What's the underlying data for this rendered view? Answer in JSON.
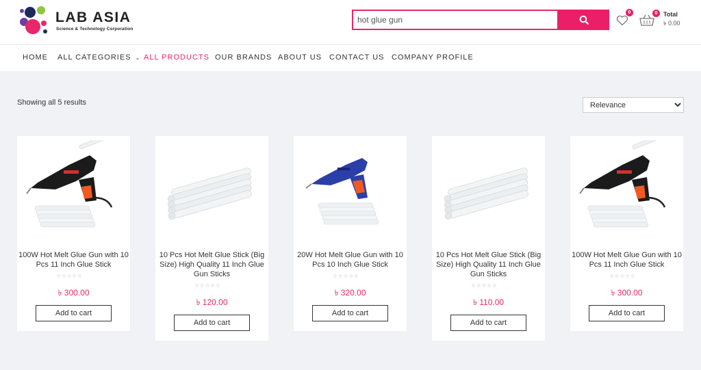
{
  "brand": {
    "title": "LAB ASIA",
    "subtitle": "Science & Technology Corporation",
    "colors": {
      "accent": "#ea1f67",
      "dot_pink": "#e8276a",
      "dot_navy": "#1f2a5c",
      "dot_green": "#8cc63f",
      "dot_purple": "#6b3fa0"
    }
  },
  "search": {
    "value": "hot glue gun",
    "button_icon": "search-icon"
  },
  "wishlist": {
    "icon": "heart-icon",
    "count": "0"
  },
  "cart": {
    "icon": "basket-icon",
    "count": "0",
    "total_label": "Total",
    "total_value": "৳ 0.00"
  },
  "nav": {
    "items": [
      {
        "label": "HOME"
      },
      {
        "label": "ALL CATEGORIES"
      },
      {
        "label": "ALL PRODUCTS"
      },
      {
        "label": "OUR BRANDS"
      },
      {
        "label": "ABOUT US"
      },
      {
        "label": "CONTACT US"
      },
      {
        "label": "COMPANY PROFILE"
      }
    ],
    "dropdown_icon": "chevron-down-icon",
    "active_index": 2
  },
  "results": {
    "count_text": "Showing all 5 results"
  },
  "sort": {
    "selected": "Relevance",
    "options": [
      "Relevance"
    ]
  },
  "products": [
    {
      "title": "100W Hot Melt Glue Gun with 10 Pcs 11 Inch Glue Stick",
      "price": "৳ 300.00",
      "rating": "☆☆☆☆☆",
      "button": "Add to cart",
      "image": "black-glue-gun"
    },
    {
      "title": "10 Pcs Hot Melt Glue Stick (Big Size) High Quality 11 Inch Glue Gun Sticks",
      "price": "৳ 120.00",
      "rating": "☆☆☆☆☆",
      "button": "Add to cart",
      "image": "glue-sticks"
    },
    {
      "title": "20W Hot Melt Glue Gun with 10 Pcs 10 Inch Glue Stick",
      "price": "৳ 320.00",
      "rating": "☆☆☆☆☆",
      "button": "Add to cart",
      "image": "blue-glue-gun"
    },
    {
      "title": "10 Pcs Hot Melt Glue Stick (Big Size) High Quality 11 Inch Glue Gun Sticks",
      "price": "৳ 110.00",
      "rating": "☆☆☆☆☆",
      "button": "Add to cart",
      "image": "glue-sticks"
    },
    {
      "title": "100W Hot Melt Glue Gun with 10 Pcs 11 Inch Glue Stick",
      "price": "৳ 300.00",
      "rating": "☆☆☆☆☆",
      "button": "Add to cart",
      "image": "black-glue-gun"
    }
  ]
}
